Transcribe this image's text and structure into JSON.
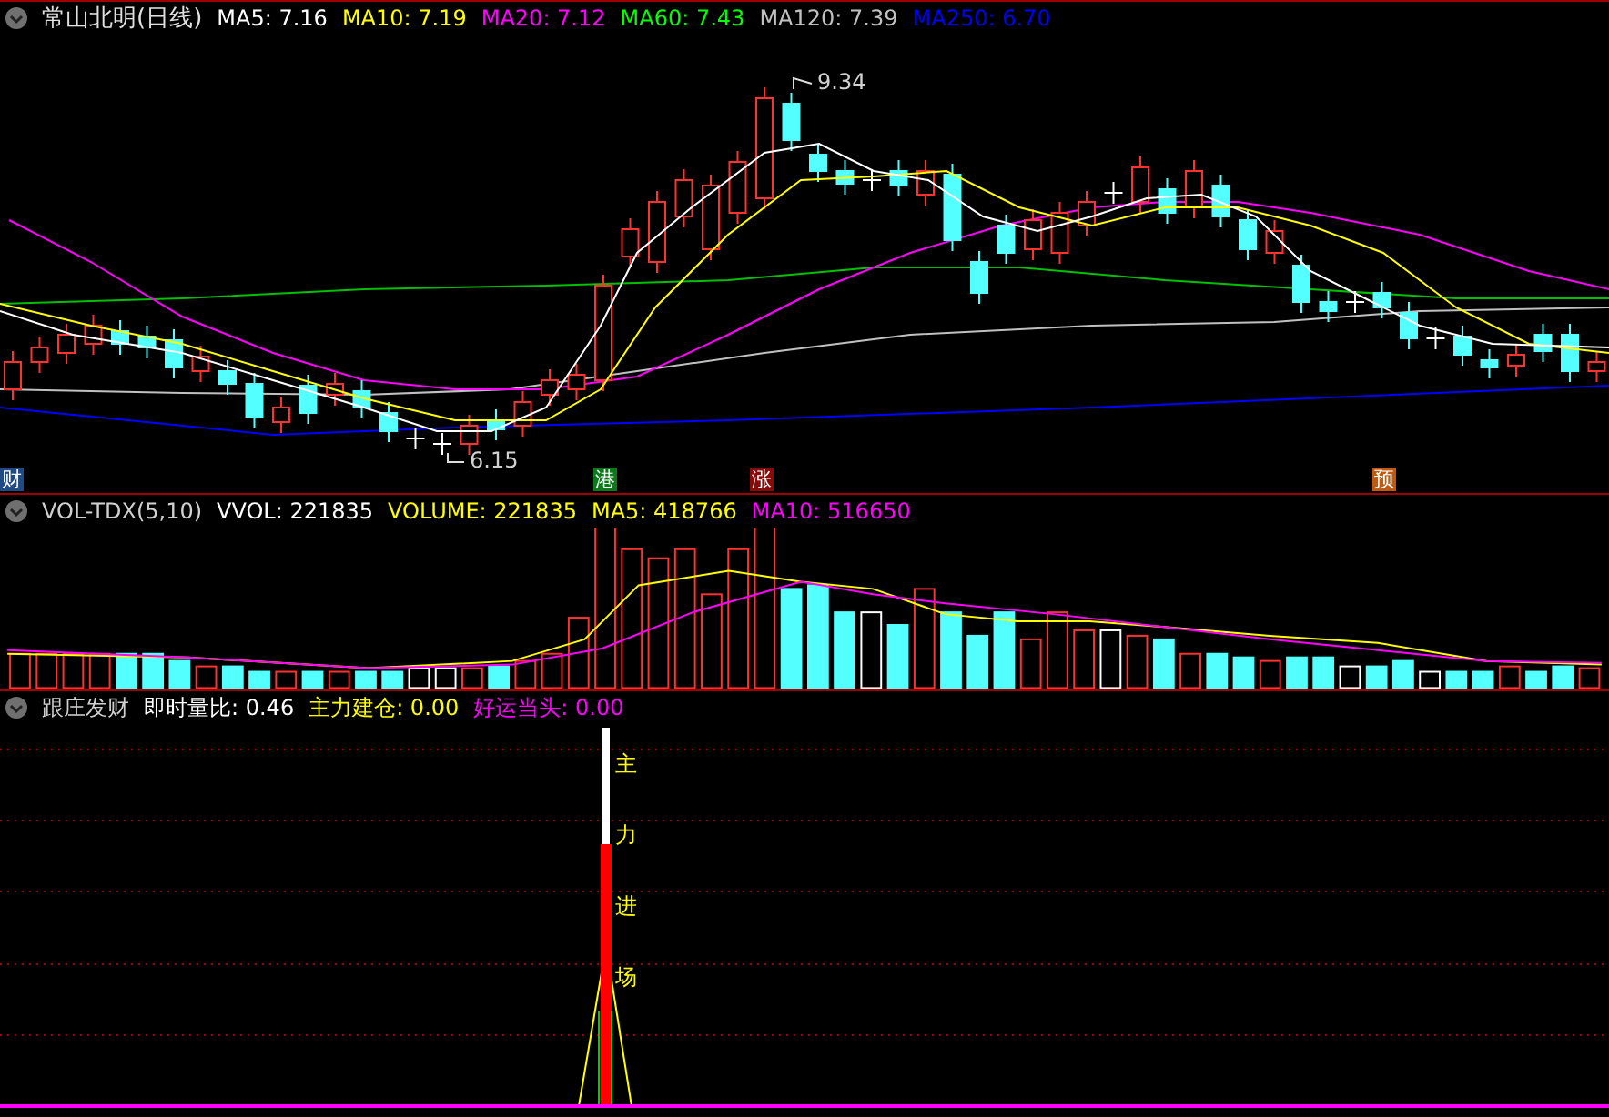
{
  "price_panel": {
    "title": "常山北明(日线)",
    "indicators": [
      {
        "text": "MA5: 7.16",
        "color": "#ffffff"
      },
      {
        "text": "MA10: 7.19",
        "color": "#ffff00"
      },
      {
        "text": "MA20: 7.12",
        "color": "#ff00ff"
      },
      {
        "text": "MA60: 7.43",
        "color": "#00ff00"
      },
      {
        "text": "MA120: 7.39",
        "color": "#c0c0c0"
      },
      {
        "text": "MA250: 6.70",
        "color": "#0000ff"
      }
    ],
    "price_marks": [
      {
        "text": "9.34"
      },
      {
        "text": "6.15"
      }
    ],
    "tags": [
      {
        "text": "财",
        "color": "#1f4a86"
      },
      {
        "text": "港",
        "color": "#0a7a1a"
      },
      {
        "text": "涨",
        "color": "#8a0a0a"
      },
      {
        "text": "预",
        "color": "#c05a10"
      }
    ]
  },
  "volume_panel": {
    "title": "VOL-TDX(5,10)",
    "indicators": [
      {
        "text": "VVOL: 221835",
        "color": "#ffffff"
      },
      {
        "text": "VOLUME: 221835",
        "color": "#ffff00"
      },
      {
        "text": "MA5: 418766",
        "color": "#ffff00"
      },
      {
        "text": "MA10: 516650",
        "color": "#ff00ff"
      }
    ]
  },
  "signal_panel": {
    "title": "跟庄发财",
    "indicators": [
      {
        "text": "即时量比: 0.46",
        "color": "#ffffff"
      },
      {
        "text": "主力建仓: 0.00",
        "color": "#ffff00"
      },
      {
        "text": "好运当头: 0.00",
        "color": "#ff00ff"
      }
    ],
    "vertical_signal": "主力进场"
  }
}
